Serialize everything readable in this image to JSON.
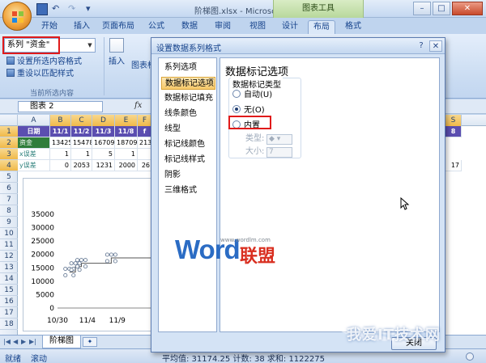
{
  "window": {
    "title": "阶梯图.xlsx - Microsoft Excel",
    "context_group": "图表工具"
  },
  "ribbon": {
    "tabs": [
      "开始",
      "插入",
      "页面布局",
      "公式",
      "数据",
      "审阅",
      "视图",
      "设计",
      "布局",
      "格式"
    ],
    "active_tab": "布局",
    "selection_dropdown": "系列 \"资金\"",
    "format_selection": "设置所选内容格式",
    "reset_style": "重设以匹配样式",
    "group_label": "当前所选内容",
    "insert_label": "插入",
    "chart_title_label": "图表标"
  },
  "namebox": {
    "value": "图表 2",
    "fx": "fx"
  },
  "sheet": {
    "columns": [
      "A",
      "B",
      "C",
      "D",
      "E",
      "F"
    ],
    "right_columns": [
      "S"
    ],
    "rows": [
      "1",
      "2",
      "3",
      "4",
      "5",
      "6",
      "7",
      "8",
      "9",
      "10",
      "11",
      "12",
      "13",
      "14",
      "15",
      "16",
      "17",
      "18"
    ],
    "row1": [
      "日期",
      "11/1",
      "11/2",
      "11/3",
      "11/8",
      "f"
    ],
    "row1_right": "8",
    "row2": [
      "资金",
      "13425",
      "15478",
      "16709",
      "18709",
      "213"
    ],
    "row3": [
      "x误差",
      "1",
      "1",
      "5",
      "1",
      ""
    ],
    "row4": [
      "y误差",
      "0",
      "2053",
      "1231",
      "2000",
      "26"
    ],
    "row4_right": "17"
  },
  "chart_data": {
    "type": "line",
    "subtype": "step",
    "y_ticks": [
      "35000",
      "30000",
      "25000",
      "20000",
      "15000",
      "10000",
      "5000",
      "0"
    ],
    "x_ticks": [
      "10/30",
      "11/4",
      "11/9"
    ],
    "ylim": [
      0,
      35000
    ],
    "series": [
      {
        "name": "资金",
        "x": [
          "11/1",
          "11/2",
          "11/3",
          "11/8"
        ],
        "values": [
          13425,
          15478,
          16709,
          18709
        ]
      }
    ]
  },
  "dialog": {
    "title": "设置数据系列格式",
    "nav_items": [
      "系列选项",
      "数据标记选项",
      "数据标记填充",
      "线条颜色",
      "线型",
      "标记线颜色",
      "标记线样式",
      "阴影",
      "三维格式"
    ],
    "active_nav": "数据标记选项",
    "panel_heading": "数据标记选项",
    "type_group_label": "数据标记类型",
    "radio_auto": "自动(U)",
    "radio_none": "无(O)",
    "radio_builtin": "内置",
    "type_label": "类型:",
    "size_label": "大小:",
    "size_value": "7",
    "close_button": "关闭"
  },
  "sheet_tabs": {
    "active": "阶梯图"
  },
  "status": {
    "ready": "就绪",
    "scroll": "滚动",
    "stats": "平均值: 31174.25    计数: 38    求和: 1122275"
  },
  "watermark": {
    "url": "www.wordlm.com",
    "word": "Word",
    "cn": "联盟",
    "site": "我爱IT技术网"
  },
  "colors": {
    "highlight_red": "#e01a1a",
    "header_purple": "#5b4eb0",
    "accent_blue": "#15428b"
  }
}
